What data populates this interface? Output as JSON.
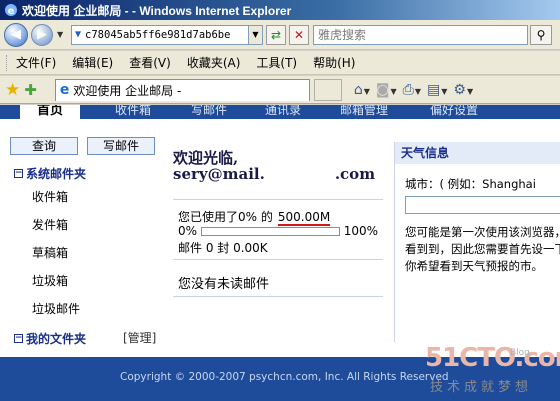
{
  "window": {
    "title": "欢迎使用 企业邮局 - - Windows Internet Explorer"
  },
  "address_bar": {
    "url": "c78045ab5ff6e981d7ab6be",
    "search_placeholder": "雅虎搜索"
  },
  "menu": {
    "items": [
      "文件(F)",
      "编辑(E)",
      "查看(V)",
      "收藏夹(A)",
      "工具(T)",
      "帮助(H)"
    ]
  },
  "tab": {
    "title": "欢迎使用 企业邮局 -"
  },
  "mail_nav": {
    "active": "首页",
    "links": [
      "收件箱",
      "写邮件",
      "通讯录",
      "邮箱管理",
      "偏好设置"
    ]
  },
  "sidebar": {
    "query_button": "查询",
    "write_button": "写邮件",
    "system_folders_title": "系统邮件夹",
    "folders": [
      "收件箱",
      "发件箱",
      "草稿箱",
      "垃圾箱",
      "垃圾邮件"
    ],
    "my_folders_title": "我的文件夹",
    "manage_label": "[管理]",
    "toggle_symbol": "−"
  },
  "main": {
    "welcome": "欢迎光临,",
    "email": "sery@mail.",
    "email_suffix": ".com",
    "usage_text": "您已使用了0% 的",
    "quota": "500.00M",
    "pct_left": "0%",
    "pct_right": "100%",
    "usage_fraction": 0,
    "mail_count": "邮件 0 封 0.00K",
    "unread": "您没有未读邮件"
  },
  "weather": {
    "title": "天气信息",
    "city_label": "城市：( 例如：Shanghai",
    "note": "您可能是第一次使用该浏览器，看到到，因此您需要首先设一下你希望看到天气预报的市。"
  },
  "footer": {
    "copyright": "Copyright © 2000-2007 psychcn.com, Inc. All Rights Reserved"
  },
  "watermark": {
    "logo": "51CTO.com",
    "sub": "技术成就梦想",
    "blog": "Blog"
  }
}
